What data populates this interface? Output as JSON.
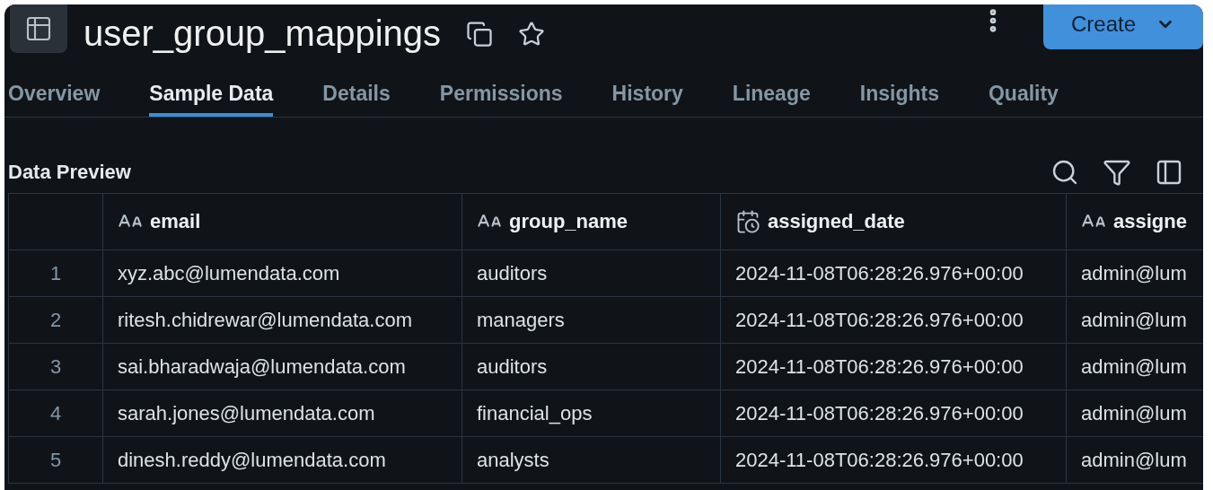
{
  "header": {
    "title": "user_group_mappings",
    "create_button": "Create"
  },
  "tabs": [
    {
      "label": "Overview",
      "selected": false
    },
    {
      "label": "Sample Data",
      "selected": true
    },
    {
      "label": "Details",
      "selected": false
    },
    {
      "label": "Permissions",
      "selected": false
    },
    {
      "label": "History",
      "selected": false
    },
    {
      "label": "Lineage",
      "selected": false
    },
    {
      "label": "Insights",
      "selected": false
    },
    {
      "label": "Quality",
      "selected": false
    }
  ],
  "section_title": "Data Preview",
  "table": {
    "columns": [
      {
        "label": "email",
        "kind": "text"
      },
      {
        "label": "group_name",
        "kind": "text"
      },
      {
        "label": "assigned_date",
        "kind": "datetime"
      },
      {
        "label": "assigne",
        "kind": "text"
      }
    ],
    "rows": [
      {
        "index": "1",
        "cells": [
          "xyz.abc@lumendata.com",
          "auditors",
          "2024-11-08T06:28:26.976+00:00",
          "admin@lum"
        ]
      },
      {
        "index": "2",
        "cells": [
          "ritesh.chidrewar@lumendata.com",
          "managers",
          "2024-11-08T06:28:26.976+00:00",
          "admin@lum"
        ]
      },
      {
        "index": "3",
        "cells": [
          "sai.bharadwaja@lumendata.com",
          "auditors",
          "2024-11-08T06:28:26.976+00:00",
          "admin@lum"
        ]
      },
      {
        "index": "4",
        "cells": [
          "sarah.jones@lumendata.com",
          "financial_ops",
          "2024-11-08T06:28:26.976+00:00",
          "admin@lum"
        ]
      },
      {
        "index": "5",
        "cells": [
          "dinesh.reddy@lumendata.com",
          "analysts",
          "2024-11-08T06:28:26.976+00:00",
          "admin@lum"
        ]
      }
    ]
  }
}
